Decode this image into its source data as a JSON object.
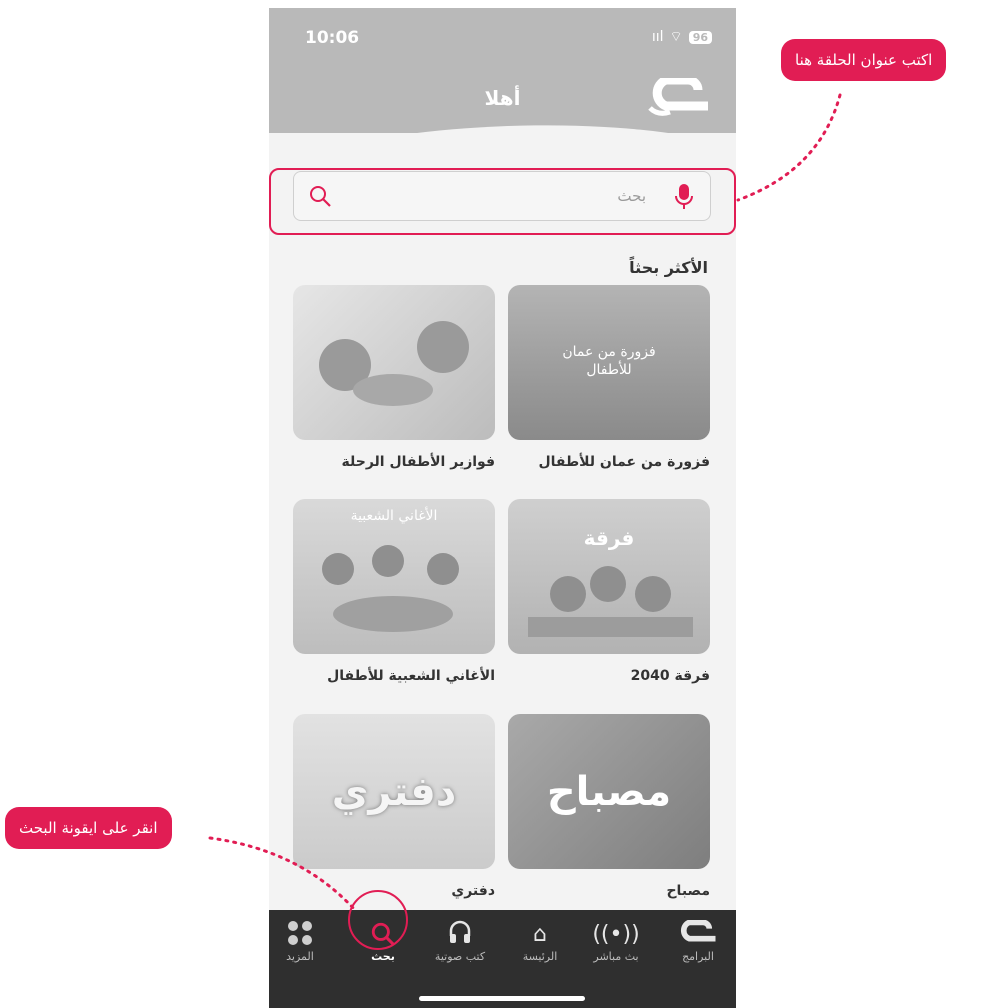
{
  "status": {
    "time": "10:06",
    "signal": "ııl",
    "wifi": "⌔",
    "battery": "96"
  },
  "header": {
    "greeting": "أهلا"
  },
  "search": {
    "placeholder": "بحث"
  },
  "section": {
    "title": "الأكثر بحثاً"
  },
  "cards": [
    {
      "label": "فزورة من عمان للأطفال",
      "thumb_text": "فزورة من عمان\nللأطفال"
    },
    {
      "label": "فوازير الأطفال الرحلة",
      "thumb_text": ""
    },
    {
      "label": "فرقة 2040",
      "thumb_text": "فرقة"
    },
    {
      "label": "الأغاني الشعبية للأطفال",
      "thumb_text": "الأغاني الشعبية"
    },
    {
      "label": "مصباح",
      "thumb_text": "مصباح"
    },
    {
      "label": "دفتري",
      "thumb_text": "دفتري"
    }
  ],
  "tabs": [
    {
      "label": "البرامج",
      "icon": "programs-logo-icon"
    },
    {
      "label": "بث مباشر",
      "icon": "live-broadcast-icon"
    },
    {
      "label": "الرئيسة",
      "icon": "home-icon"
    },
    {
      "label": "كتب صوتية",
      "icon": "headphones-icon"
    },
    {
      "label": "بحث",
      "icon": "search-icon",
      "active": true
    },
    {
      "label": "المزيد",
      "icon": "more-grid-icon"
    }
  ],
  "callouts": {
    "top": "اكتب عنوان الحلقة هنا",
    "bottom": "انقر على ايقونة البحث"
  },
  "colors": {
    "accent": "#e11d54",
    "header": "#b9b9b9",
    "tabbar": "#2f2f2f"
  }
}
